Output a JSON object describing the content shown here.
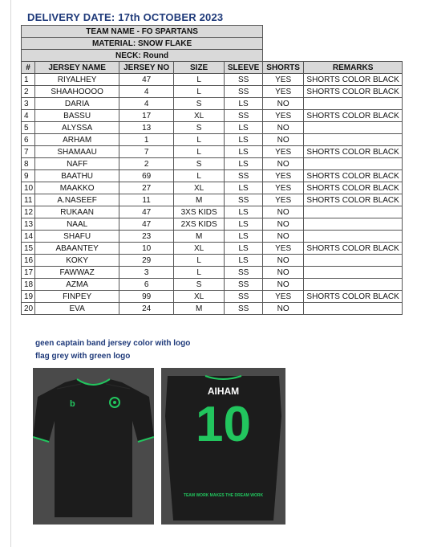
{
  "delivery_date": "DELIVERY DATE: 17th OCTOBER 2023",
  "header": {
    "team": "TEAM NAME - FO SPARTANS",
    "material": "MATERIAL: SNOW FLAKE",
    "neck": "NECK: Round"
  },
  "columns": [
    "#",
    "JERSEY NAME",
    "JERSEY NO",
    "SIZE",
    "SLEEVE",
    "SHORTS",
    "REMARKS"
  ],
  "rows": [
    {
      "n": "1",
      "name": "RIYALHEY",
      "no": "47",
      "size": "L",
      "sleeve": "SS",
      "shorts": "YES",
      "remarks": "SHORTS COLOR BLACK"
    },
    {
      "n": "2",
      "name": "SHAAHOOOO",
      "no": "4",
      "size": "L",
      "sleeve": "SS",
      "shorts": "YES",
      "remarks": "SHORTS COLOR BLACK"
    },
    {
      "n": "3",
      "name": "DARIA",
      "no": "4",
      "size": "S",
      "sleeve": "LS",
      "shorts": "NO",
      "remarks": ""
    },
    {
      "n": "4",
      "name": "BASSU",
      "no": "17",
      "size": "XL",
      "sleeve": "SS",
      "shorts": "YES",
      "remarks": "SHORTS COLOR BLACK"
    },
    {
      "n": "5",
      "name": "ALYSSA",
      "no": "13",
      "size": "S",
      "sleeve": "LS",
      "shorts": "NO",
      "remarks": ""
    },
    {
      "n": "6",
      "name": "ARHAM",
      "no": "1",
      "size": "L",
      "sleeve": "LS",
      "shorts": "NO",
      "remarks": ""
    },
    {
      "n": "7",
      "name": "SHAMAAU",
      "no": "7",
      "size": "L",
      "sleeve": "LS",
      "shorts": "YES",
      "remarks": "SHORTS COLOR BLACK"
    },
    {
      "n": "8",
      "name": "NAFF",
      "no": "2",
      "size": "S",
      "sleeve": "LS",
      "shorts": "NO",
      "remarks": ""
    },
    {
      "n": "9",
      "name": "BAATHU",
      "no": "69",
      "size": "L",
      "sleeve": "SS",
      "shorts": "YES",
      "remarks": "SHORTS COLOR BLACK"
    },
    {
      "n": "10",
      "name": "MAAKKO",
      "no": "27",
      "size": "XL",
      "sleeve": "LS",
      "shorts": "YES",
      "remarks": "SHORTS COLOR BLACK"
    },
    {
      "n": "11",
      "name": "A.NASEEF",
      "no": "11",
      "size": "M",
      "sleeve": "SS",
      "shorts": "YES",
      "remarks": "SHORTS COLOR BLACK"
    },
    {
      "n": "12",
      "name": "RUKAAN",
      "no": "47",
      "size": "3XS KIDS",
      "sleeve": "LS",
      "shorts": "NO",
      "remarks": ""
    },
    {
      "n": "13",
      "name": "NAAL",
      "no": "47",
      "size": "2XS KIDS",
      "sleeve": "LS",
      "shorts": "NO",
      "remarks": ""
    },
    {
      "n": "14",
      "name": "SHAFU",
      "no": "23",
      "size": "M",
      "sleeve": "LS",
      "shorts": "NO",
      "remarks": ""
    },
    {
      "n": "15",
      "name": "ABAANTEY",
      "no": "10",
      "size": "XL",
      "sleeve": "LS",
      "shorts": "YES",
      "remarks": "SHORTS COLOR BLACK"
    },
    {
      "n": "16",
      "name": "KOKY",
      "no": "29",
      "size": "L",
      "sleeve": "LS",
      "shorts": "NO",
      "remarks": ""
    },
    {
      "n": "17",
      "name": "FAWWAZ",
      "no": "3",
      "size": "L",
      "sleeve": "SS",
      "shorts": "NO",
      "remarks": ""
    },
    {
      "n": "18",
      "name": "AZMA",
      "no": "6",
      "size": "S",
      "sleeve": "SS",
      "shorts": "NO",
      "remarks": ""
    },
    {
      "n": "19",
      "name": "FINPEY",
      "no": "99",
      "size": "XL",
      "sleeve": "SS",
      "shorts": "YES",
      "remarks": "SHORTS COLOR BLACK"
    },
    {
      "n": "20",
      "name": "EVA",
      "no": "24",
      "size": "M",
      "sleeve": "SS",
      "shorts": "NO",
      "remarks": ""
    }
  ],
  "notes": [
    "geen captain band jersey color with logo",
    "flag grey with green logo"
  ],
  "jersey_back": {
    "name": "AIHAM",
    "number": "10",
    "slogan": "TEAM WORK MAKES THE DREAM WORK"
  },
  "colors": {
    "accent_green": "#22c55e",
    "jersey_black": "#1c1c1c",
    "photo_bg": "#4a4a4a",
    "heading_blue": "#1f3a7a"
  }
}
